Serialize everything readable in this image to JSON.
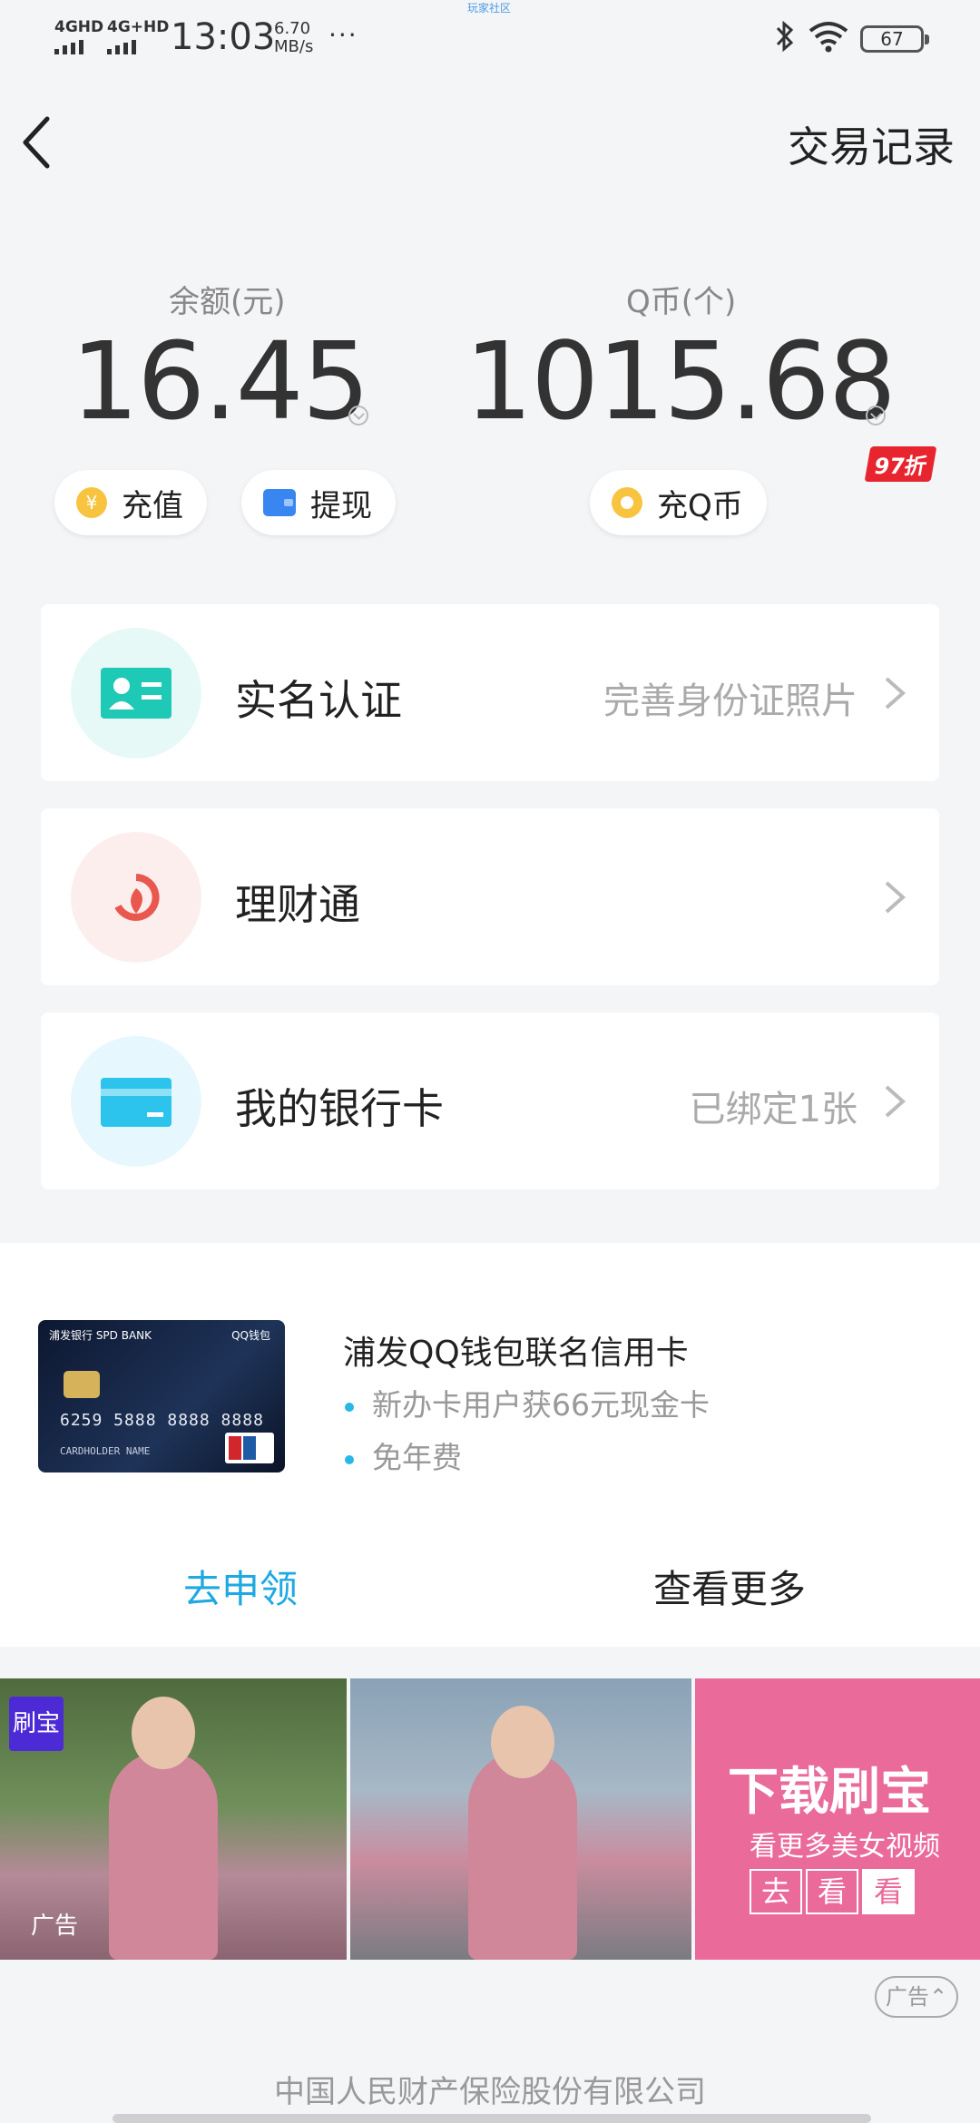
{
  "status_bar": {
    "net1": "4GHD",
    "net2": "4G+HD",
    "time": "13:03",
    "speed_value": "6.70",
    "speed_unit": "MB/s",
    "dots": "···",
    "tiny_text": "玩家社区",
    "battery": "67"
  },
  "header": {
    "transaction_records": "交易记录"
  },
  "balance": {
    "label": "余额(元)",
    "value": "16.45",
    "recharge": "充值",
    "withdraw": "提现"
  },
  "qcoin": {
    "label": "Q币(个)",
    "value": "1015.68",
    "recharge": "充Q币",
    "discount_badge": "97折"
  },
  "cards": [
    {
      "title": "实名认证",
      "sub": "完善身份证照片"
    },
    {
      "title": "理财通",
      "sub": ""
    },
    {
      "title": "我的银行卡",
      "sub": "已绑定1张"
    }
  ],
  "promo": {
    "title": "浦发QQ钱包联名信用卡",
    "bullets": [
      "新办卡用户获66元现金卡",
      "免年费"
    ],
    "apply": "去申领",
    "more": "查看更多",
    "card_bank": "浦发银行 SPD BANK",
    "card_qq": "QQ钱包",
    "card_number": "6259 5888 8888 8888",
    "card_holder": "CARDHOLDER NAME"
  },
  "ad": {
    "logo": "刷宝",
    "tag": "广告",
    "headline": "下载刷宝",
    "subline": "看更多美女视频",
    "button_chars": [
      "去",
      "看",
      "看"
    ],
    "collapse_label": "广告"
  },
  "footer": {
    "company": "中国人民财产保险股份有限公司"
  },
  "colors": {
    "accent": "#1fa9e1",
    "discount_red": "#e8242f",
    "id_icon": "#1ec9b6",
    "licaitong_icon": "#e9584f",
    "bankcard_icon": "#2cc3ec",
    "ad_pink": "#ea6a9a"
  }
}
